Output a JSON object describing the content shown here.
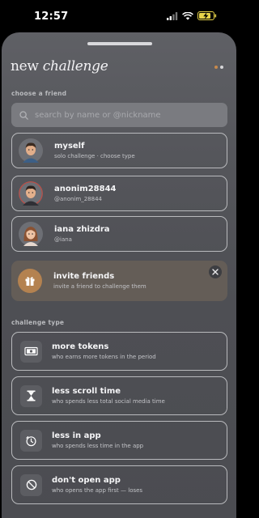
{
  "status_bar": {
    "time": "12:57"
  },
  "header": {
    "title_regular": "new",
    "title_italic": "challenge"
  },
  "friends": {
    "section_label": "choose a friend",
    "search_placeholder": "search by name or @nickname",
    "items": [
      {
        "name": "myself",
        "sub": "solo challenge · choose type"
      },
      {
        "name": "anonim28844",
        "sub": "@anonim_28844"
      },
      {
        "name": "iana zhizdra",
        "sub": "@iana"
      }
    ]
  },
  "invite": {
    "title": "invite friends",
    "sub": "invite a friend to challenge them"
  },
  "challenge_type": {
    "section_label": "challenge type",
    "items": [
      {
        "title": "more tokens",
        "sub": "who earns more tokens in the period",
        "icon": "tokens-icon"
      },
      {
        "title": "less scroll time",
        "sub": "who spends less total social media time",
        "icon": "hourglass-icon"
      },
      {
        "title": "less in app",
        "sub": "who spends less time in the app",
        "icon": "timer-icon"
      },
      {
        "title": "don't open app",
        "sub": "who opens the app first — loses",
        "icon": "block-icon"
      }
    ]
  },
  "colors": {
    "accent": "#b48250",
    "dot_active": "#c78a4c",
    "dot_inactive": "#d6d6d8"
  }
}
